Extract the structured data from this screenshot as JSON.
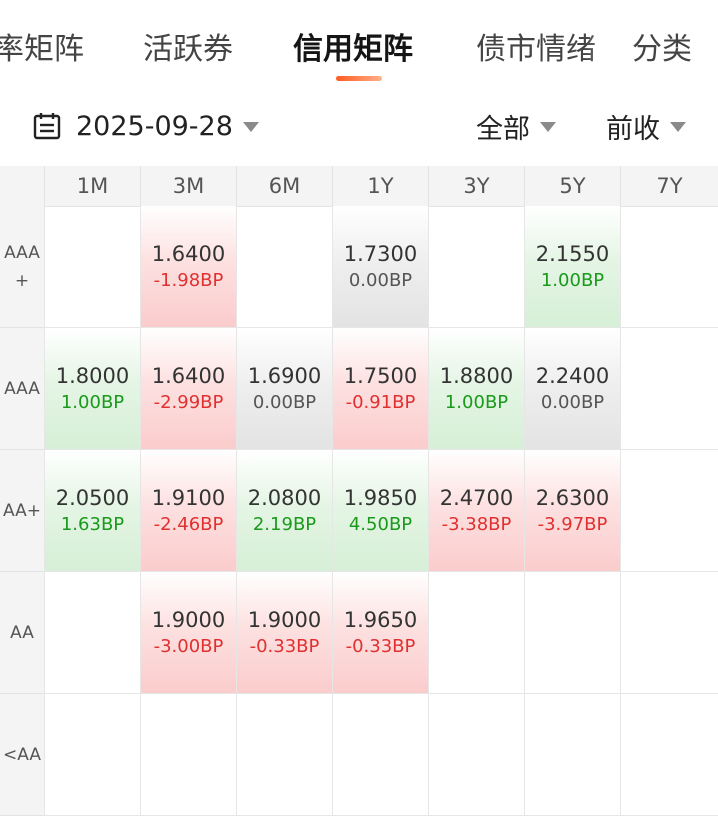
{
  "tabs": [
    {
      "label": "率矩阵",
      "active": false
    },
    {
      "label": "活跃券",
      "active": false
    },
    {
      "label": "信用矩阵",
      "active": true
    },
    {
      "label": "债市情绪",
      "active": false
    },
    {
      "label": "分类",
      "active": false
    }
  ],
  "filters": {
    "date": "2025-09-28",
    "category": "全部",
    "price_basis": "前收"
  },
  "matrix": {
    "columns": [
      "1M",
      "3M",
      "6M",
      "1Y",
      "3Y",
      "5Y",
      "7Y"
    ],
    "rows": [
      {
        "label": "AAA\n+",
        "cells": [
          null,
          {
            "yield": "1.6400",
            "bp": "-1.98BP",
            "trend": "up"
          },
          null,
          {
            "yield": "1.7300",
            "bp": "0.00BP",
            "trend": "flat"
          },
          null,
          {
            "yield": "2.1550",
            "bp": "1.00BP",
            "trend": "down"
          },
          null
        ]
      },
      {
        "label": "AAA",
        "cells": [
          {
            "yield": "1.8000",
            "bp": "1.00BP",
            "trend": "down"
          },
          {
            "yield": "1.6400",
            "bp": "-2.99BP",
            "trend": "up"
          },
          {
            "yield": "1.6900",
            "bp": "0.00BP",
            "trend": "flat"
          },
          {
            "yield": "1.7500",
            "bp": "-0.91BP",
            "trend": "up"
          },
          {
            "yield": "1.8800",
            "bp": "1.00BP",
            "trend": "down"
          },
          {
            "yield": "2.2400",
            "bp": "0.00BP",
            "trend": "flat"
          },
          null
        ]
      },
      {
        "label": "AA+",
        "cells": [
          {
            "yield": "2.0500",
            "bp": "1.63BP",
            "trend": "down"
          },
          {
            "yield": "1.9100",
            "bp": "-2.46BP",
            "trend": "up"
          },
          {
            "yield": "2.0800",
            "bp": "2.19BP",
            "trend": "down"
          },
          {
            "yield": "1.9850",
            "bp": "4.50BP",
            "trend": "down"
          },
          {
            "yield": "2.4700",
            "bp": "-3.38BP",
            "trend": "up"
          },
          {
            "yield": "2.6300",
            "bp": "-3.97BP",
            "trend": "up"
          },
          null
        ]
      },
      {
        "label": "AA",
        "cells": [
          null,
          {
            "yield": "1.9000",
            "bp": "-3.00BP",
            "trend": "up"
          },
          {
            "yield": "1.9000",
            "bp": "-0.33BP",
            "trend": "up"
          },
          {
            "yield": "1.9650",
            "bp": "-0.33BP",
            "trend": "up"
          },
          null,
          null,
          null
        ]
      },
      {
        "label": "<AA",
        "cells": [
          null,
          null,
          null,
          null,
          null,
          null,
          null
        ]
      }
    ]
  },
  "icons": {
    "date_picker": "calendar-icon",
    "dropdown": "caret-down-icon"
  },
  "colors": {
    "accent": "#ff5a1f",
    "up": "#e03030",
    "down": "#1a9a1a",
    "flat": "#555555",
    "up_bg": "#fbcccc",
    "down_bg": "#d6efd6",
    "flat_bg": "#e3e3e3"
  }
}
